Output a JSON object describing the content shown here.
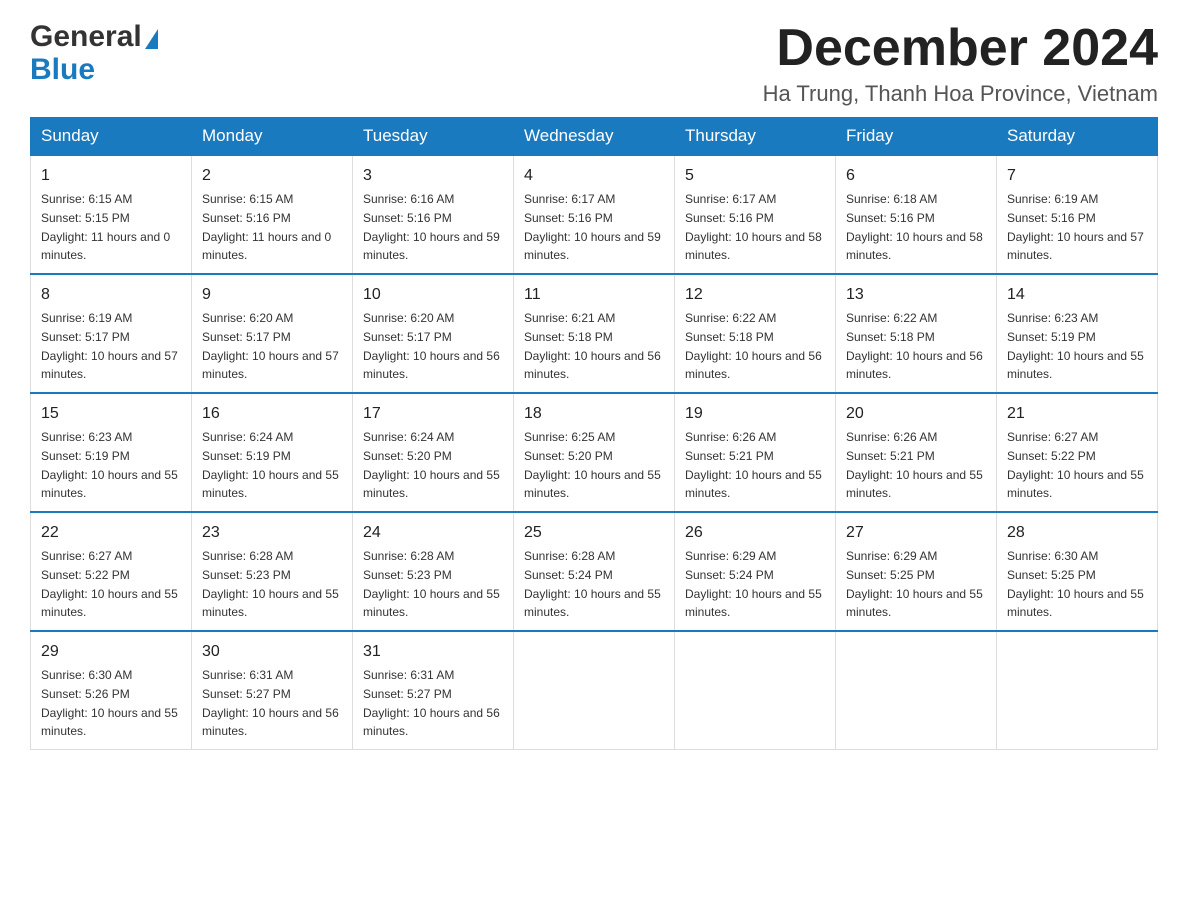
{
  "header": {
    "logo_general": "General",
    "logo_blue": "Blue",
    "month_title": "December 2024",
    "location": "Ha Trung, Thanh Hoa Province, Vietnam"
  },
  "weekdays": [
    "Sunday",
    "Monday",
    "Tuesday",
    "Wednesday",
    "Thursday",
    "Friday",
    "Saturday"
  ],
  "weeks": [
    [
      {
        "day": "1",
        "sunrise": "6:15 AM",
        "sunset": "5:15 PM",
        "daylight": "11 hours and 0 minutes."
      },
      {
        "day": "2",
        "sunrise": "6:15 AM",
        "sunset": "5:16 PM",
        "daylight": "11 hours and 0 minutes."
      },
      {
        "day": "3",
        "sunrise": "6:16 AM",
        "sunset": "5:16 PM",
        "daylight": "10 hours and 59 minutes."
      },
      {
        "day": "4",
        "sunrise": "6:17 AM",
        "sunset": "5:16 PM",
        "daylight": "10 hours and 59 minutes."
      },
      {
        "day": "5",
        "sunrise": "6:17 AM",
        "sunset": "5:16 PM",
        "daylight": "10 hours and 58 minutes."
      },
      {
        "day": "6",
        "sunrise": "6:18 AM",
        "sunset": "5:16 PM",
        "daylight": "10 hours and 58 minutes."
      },
      {
        "day": "7",
        "sunrise": "6:19 AM",
        "sunset": "5:16 PM",
        "daylight": "10 hours and 57 minutes."
      }
    ],
    [
      {
        "day": "8",
        "sunrise": "6:19 AM",
        "sunset": "5:17 PM",
        "daylight": "10 hours and 57 minutes."
      },
      {
        "day": "9",
        "sunrise": "6:20 AM",
        "sunset": "5:17 PM",
        "daylight": "10 hours and 57 minutes."
      },
      {
        "day": "10",
        "sunrise": "6:20 AM",
        "sunset": "5:17 PM",
        "daylight": "10 hours and 56 minutes."
      },
      {
        "day": "11",
        "sunrise": "6:21 AM",
        "sunset": "5:18 PM",
        "daylight": "10 hours and 56 minutes."
      },
      {
        "day": "12",
        "sunrise": "6:22 AM",
        "sunset": "5:18 PM",
        "daylight": "10 hours and 56 minutes."
      },
      {
        "day": "13",
        "sunrise": "6:22 AM",
        "sunset": "5:18 PM",
        "daylight": "10 hours and 56 minutes."
      },
      {
        "day": "14",
        "sunrise": "6:23 AM",
        "sunset": "5:19 PM",
        "daylight": "10 hours and 55 minutes."
      }
    ],
    [
      {
        "day": "15",
        "sunrise": "6:23 AM",
        "sunset": "5:19 PM",
        "daylight": "10 hours and 55 minutes."
      },
      {
        "day": "16",
        "sunrise": "6:24 AM",
        "sunset": "5:19 PM",
        "daylight": "10 hours and 55 minutes."
      },
      {
        "day": "17",
        "sunrise": "6:24 AM",
        "sunset": "5:20 PM",
        "daylight": "10 hours and 55 minutes."
      },
      {
        "day": "18",
        "sunrise": "6:25 AM",
        "sunset": "5:20 PM",
        "daylight": "10 hours and 55 minutes."
      },
      {
        "day": "19",
        "sunrise": "6:26 AM",
        "sunset": "5:21 PM",
        "daylight": "10 hours and 55 minutes."
      },
      {
        "day": "20",
        "sunrise": "6:26 AM",
        "sunset": "5:21 PM",
        "daylight": "10 hours and 55 minutes."
      },
      {
        "day": "21",
        "sunrise": "6:27 AM",
        "sunset": "5:22 PM",
        "daylight": "10 hours and 55 minutes."
      }
    ],
    [
      {
        "day": "22",
        "sunrise": "6:27 AM",
        "sunset": "5:22 PM",
        "daylight": "10 hours and 55 minutes."
      },
      {
        "day": "23",
        "sunrise": "6:28 AM",
        "sunset": "5:23 PM",
        "daylight": "10 hours and 55 minutes."
      },
      {
        "day": "24",
        "sunrise": "6:28 AM",
        "sunset": "5:23 PM",
        "daylight": "10 hours and 55 minutes."
      },
      {
        "day": "25",
        "sunrise": "6:28 AM",
        "sunset": "5:24 PM",
        "daylight": "10 hours and 55 minutes."
      },
      {
        "day": "26",
        "sunrise": "6:29 AM",
        "sunset": "5:24 PM",
        "daylight": "10 hours and 55 minutes."
      },
      {
        "day": "27",
        "sunrise": "6:29 AM",
        "sunset": "5:25 PM",
        "daylight": "10 hours and 55 minutes."
      },
      {
        "day": "28",
        "sunrise": "6:30 AM",
        "sunset": "5:25 PM",
        "daylight": "10 hours and 55 minutes."
      }
    ],
    [
      {
        "day": "29",
        "sunrise": "6:30 AM",
        "sunset": "5:26 PM",
        "daylight": "10 hours and 55 minutes."
      },
      {
        "day": "30",
        "sunrise": "6:31 AM",
        "sunset": "5:27 PM",
        "daylight": "10 hours and 56 minutes."
      },
      {
        "day": "31",
        "sunrise": "6:31 AM",
        "sunset": "5:27 PM",
        "daylight": "10 hours and 56 minutes."
      },
      null,
      null,
      null,
      null
    ]
  ]
}
